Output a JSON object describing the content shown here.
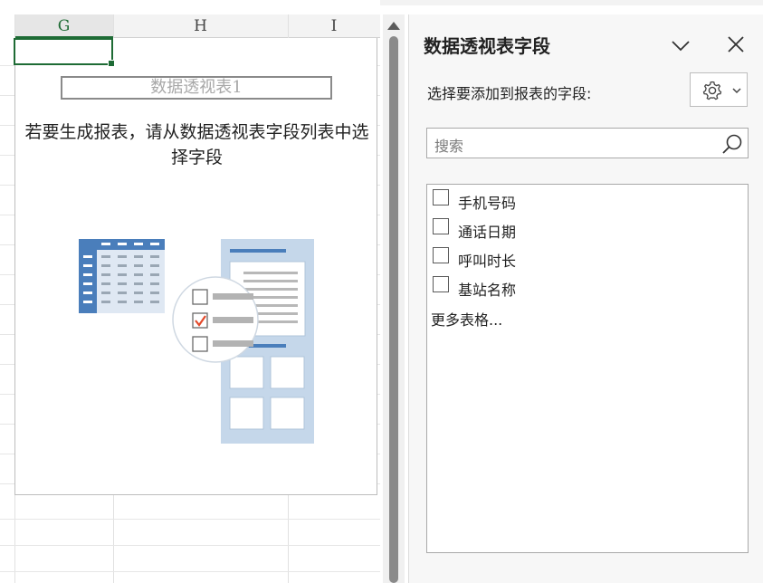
{
  "sheet": {
    "columns": [
      "G",
      "H",
      "I"
    ],
    "pivot_table_name": "数据透视表1",
    "instruction": "若要生成报表，请从数据透视表字段列表中选择字段"
  },
  "panel": {
    "title": "数据透视表字段",
    "choose_label": "选择要添加到报表的字段:",
    "search_placeholder": "搜索",
    "fields": [
      {
        "label": "手机号码",
        "checked": false
      },
      {
        "label": "通话日期",
        "checked": false
      },
      {
        "label": "呼叫时长",
        "checked": false
      },
      {
        "label": "基站名称",
        "checked": false
      }
    ],
    "more_tables": "更多表格..."
  },
  "colors": {
    "accent": "#1e6b35",
    "illus_blue": "#4a7ebb",
    "illus_light": "#c5d7ea",
    "check_red": "#e34a2b"
  }
}
